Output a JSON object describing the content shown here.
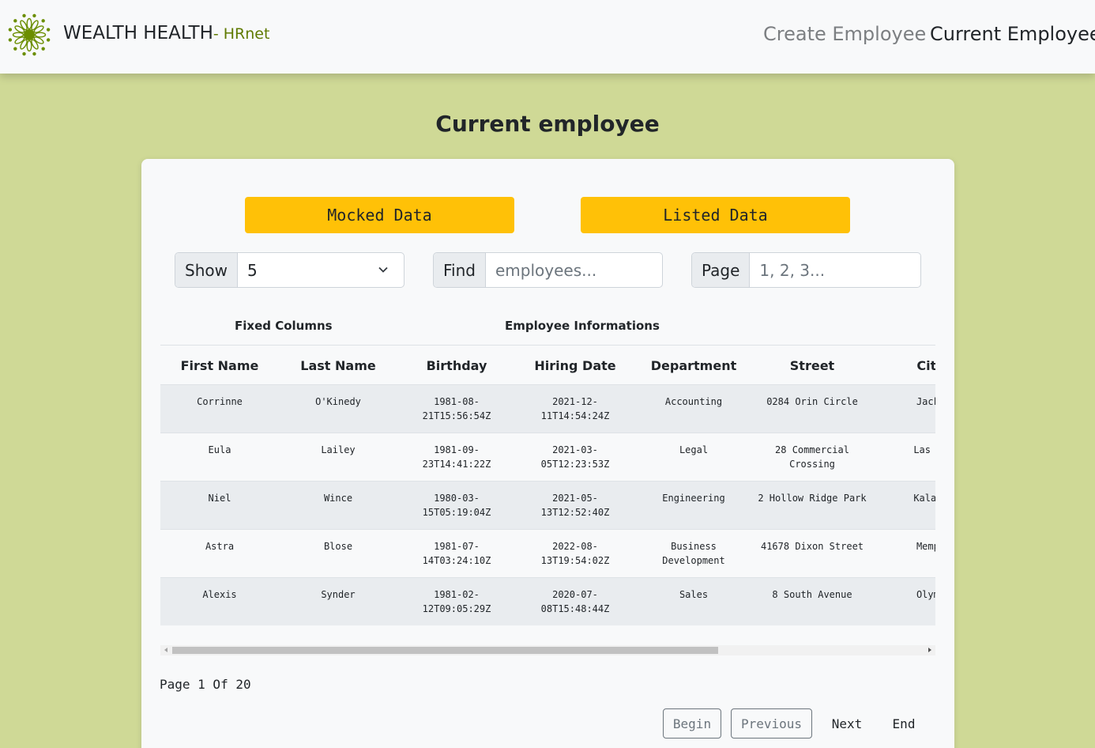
{
  "brand": {
    "name": "WEALTH HEALTH",
    "subtitle": "- HRnet"
  },
  "nav": {
    "create": "Create Employee",
    "current": "Current Employee"
  },
  "page_title": "Current employee",
  "buttons": {
    "mocked": "Mocked Data",
    "listed": "Listed Data"
  },
  "controls": {
    "show_label": "Show",
    "show_value": "5",
    "find_label": "Find",
    "find_placeholder": "employees...",
    "page_label": "Page",
    "page_placeholder": "1, 2, 3..."
  },
  "table": {
    "group_headers": {
      "fixed": "Fixed Columns",
      "info": "Employee Informations"
    },
    "columns": [
      "First Name",
      "Last Name",
      "Birthday",
      "Hiring Date",
      "Department",
      "Street",
      "City"
    ],
    "rows": [
      [
        "Corrinne",
        "O'Kinedy",
        "1981-08-21T15:56:54Z",
        "2021-12-11T14:54:24Z",
        "Accounting",
        "0284 Orin Circle",
        "Jacks"
      ],
      [
        "Eula",
        "Lailey",
        "1981-09-23T14:41:22Z",
        "2021-03-05T12:23:53Z",
        "Legal",
        "28 Commercial Crossing",
        "Las Ve"
      ],
      [
        "Niel",
        "Wince",
        "1980-03-15T05:19:04Z",
        "2021-05-13T12:52:40Z",
        "Engineering",
        "2 Hollow Ridge Park",
        "Kalama"
      ],
      [
        "Astra",
        "Blose",
        "1981-07-14T03:24:10Z",
        "2022-08-13T19:54:02Z",
        "Business Development",
        "41678 Dixon Street",
        "Memph"
      ],
      [
        "Alexis",
        "Synder",
        "1981-02-12T09:05:29Z",
        "2020-07-08T15:48:44Z",
        "Sales",
        "8 South Avenue",
        "Olymp"
      ]
    ]
  },
  "pagination": {
    "info": "Page 1 Of 20",
    "begin": "Begin",
    "previous": "Previous",
    "next": "Next",
    "end": "End"
  },
  "colors": {
    "background": "#cfd996",
    "accent": "#ffc107",
    "brand": "#5f7a00"
  }
}
